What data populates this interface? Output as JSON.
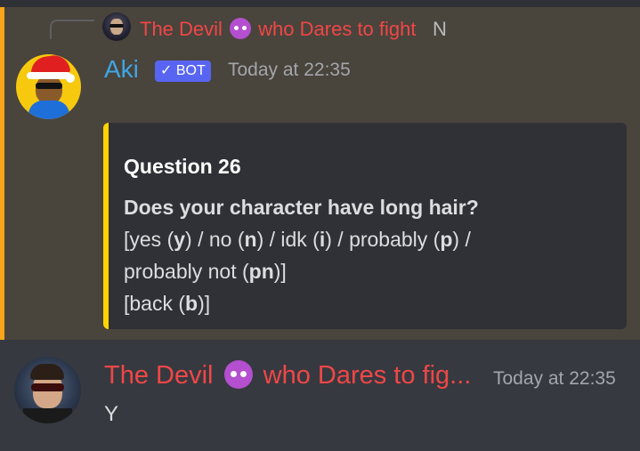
{
  "reply": {
    "author_a": "The Devil",
    "emoji": "smiling-imp",
    "author_b": "who Dares to fight",
    "preview": "N"
  },
  "bot_message": {
    "author": "Aki",
    "badge": "✓ BOT",
    "timestamp": "Today at 22:35",
    "embed": {
      "title": "Question 26",
      "question": "Does your character have long hair?",
      "options_line1_a": "[yes (",
      "options_line1_y": "y",
      "options_line1_b": ") / no (",
      "options_line1_n": "n",
      "options_line1_c": ") / idk (",
      "options_line1_i": "i",
      "options_line1_d": ") / probably (",
      "options_line1_p": "p",
      "options_line1_e": ") /",
      "options_line2_a": "probably not (",
      "options_line2_pn": "pn",
      "options_line2_b": ")]",
      "back_a": "[back (",
      "back_b": "b",
      "back_c": ")]",
      "accent_color": "#ffd400"
    }
  },
  "user_message": {
    "author_a": "The Devil",
    "emoji": "smiling-imp",
    "author_b": "who Dares to fig...",
    "timestamp": "Today at 22:35",
    "content": "Y"
  },
  "colors": {
    "background": "#36393f",
    "highlight_background": "#49443c",
    "mention_bar": "#faa61a",
    "bot_name": "#3fa6e6",
    "user_name": "#f04747",
    "bot_badge": "#5865f2"
  }
}
